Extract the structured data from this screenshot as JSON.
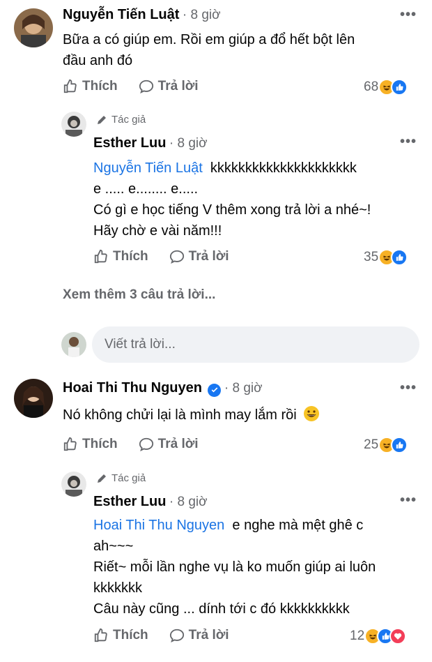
{
  "comments": [
    {
      "author": "Nguyễn Tiến Luật",
      "time": "8 giờ",
      "text_lines": [
        "Bữa a có giúp em. Rồi em giúp a đổ hết bột lên",
        "đầu anh đó"
      ],
      "like_label": "Thích",
      "reply_label": "Trả lời",
      "reaction_count": "68",
      "reactions": [
        "haha",
        "like"
      ]
    },
    {
      "author_tag": "Tác giả",
      "author": "Esther Luu",
      "time": "8 giờ",
      "mention": "Nguyễn Tiến Luật",
      "after_mention": "kkkkkkkkkkkkkkkkkkkkk",
      "text_lines": [
        "e ..... e........ e.....",
        "Có gì e học tiếng V thêm xong trả lời a nhé~!",
        "Hãy chờ e vài năm!!!"
      ],
      "like_label": "Thích",
      "reply_label": "Trả lời",
      "reaction_count": "35",
      "reactions": [
        "haha",
        "like"
      ]
    },
    {
      "author": "Hoai Thi Thu Nguyen",
      "time": "8 giờ",
      "text_lines": [
        "Nó không chửi lại là mình may lắm rồi"
      ],
      "like_label": "Thích",
      "reply_label": "Trả lời",
      "reaction_count": "25",
      "reactions": [
        "haha",
        "like"
      ]
    },
    {
      "author_tag": "Tác giả",
      "author": "Esther Luu",
      "time": "8 giờ",
      "mention": "Hoai Thi Thu Nguyen",
      "after_mention": "e nghe mà mệt ghê c",
      "text_lines": [
        "ah~~~",
        "Riết~ mỗi lần nghe vụ là ko muốn giúp ai luôn",
        "kkkkkkk",
        "Câu này cũng ... dính tới c đó kkkkkkkkkk"
      ],
      "like_label": "Thích",
      "reply_label": "Trả lời",
      "reaction_count": "12",
      "reactions": [
        "haha",
        "like",
        "love"
      ]
    }
  ],
  "see_more_replies": "Xem thêm 3 câu trả lời...",
  "reply_placeholder": "Viết trả lời...",
  "colors": {
    "mention": "#1b74e4",
    "meta": "#65676b",
    "like": "#1877f2",
    "haha": "#f7b125",
    "love": "#f33e58"
  }
}
